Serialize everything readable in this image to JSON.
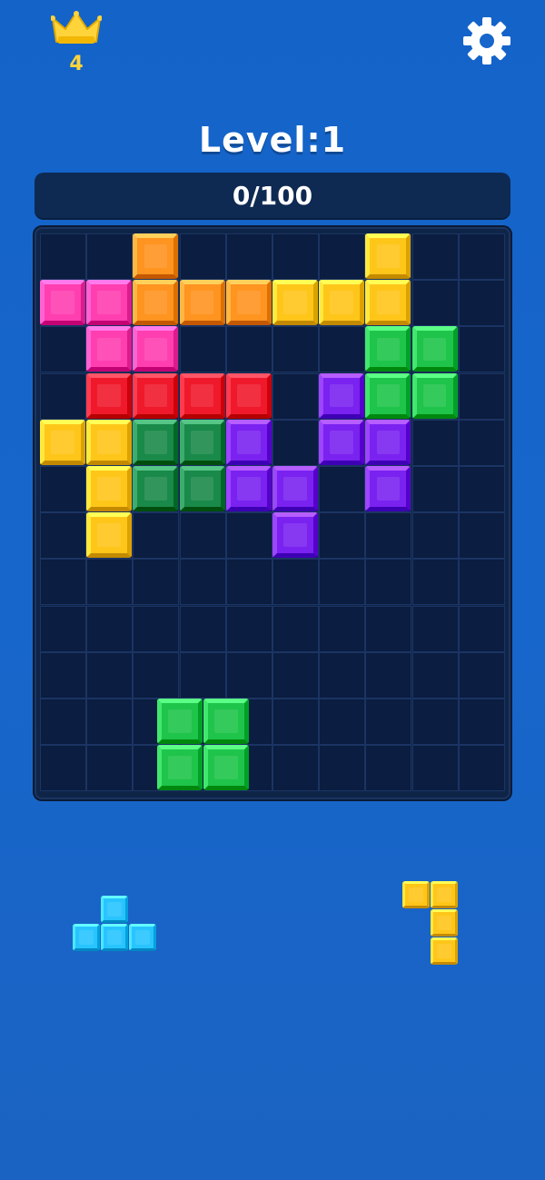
{
  "hud": {
    "crown_icon": "crown-icon",
    "crown_count": "4",
    "settings_icon": "gear-icon",
    "level_title": "Level:1",
    "progress_text": "0/100",
    "progress_fraction": 0
  },
  "colors": {
    "background": "#1766cc",
    "board": "#0f2548",
    "empty_cell": "#0b1d40",
    "orange": "#ff9420",
    "yellow": "#ffc61a",
    "pink": "#ff3fb0",
    "red": "#f0192c",
    "dark_green": "#1a8a4a",
    "green": "#1fc44a",
    "purple": "#7a22f0",
    "cyan": "#28c4ff"
  },
  "board": {
    "columns": 10,
    "rows": 12,
    "filled": [
      {
        "r": 0,
        "c": 2,
        "color": "orange"
      },
      {
        "r": 0,
        "c": 7,
        "color": "yellow"
      },
      {
        "r": 1,
        "c": 0,
        "color": "pink"
      },
      {
        "r": 1,
        "c": 1,
        "color": "pink"
      },
      {
        "r": 1,
        "c": 2,
        "color": "orange"
      },
      {
        "r": 1,
        "c": 3,
        "color": "orange"
      },
      {
        "r": 1,
        "c": 4,
        "color": "orange"
      },
      {
        "r": 1,
        "c": 5,
        "color": "yellow"
      },
      {
        "r": 1,
        "c": 6,
        "color": "yellow"
      },
      {
        "r": 1,
        "c": 7,
        "color": "yellow"
      },
      {
        "r": 2,
        "c": 1,
        "color": "pink"
      },
      {
        "r": 2,
        "c": 2,
        "color": "pink"
      },
      {
        "r": 2,
        "c": 7,
        "color": "green"
      },
      {
        "r": 2,
        "c": 8,
        "color": "green"
      },
      {
        "r": 3,
        "c": 1,
        "color": "red"
      },
      {
        "r": 3,
        "c": 2,
        "color": "red"
      },
      {
        "r": 3,
        "c": 3,
        "color": "red"
      },
      {
        "r": 3,
        "c": 4,
        "color": "red"
      },
      {
        "r": 3,
        "c": 6,
        "color": "purple"
      },
      {
        "r": 3,
        "c": 7,
        "color": "green"
      },
      {
        "r": 3,
        "c": 8,
        "color": "green"
      },
      {
        "r": 4,
        "c": 0,
        "color": "yellow"
      },
      {
        "r": 4,
        "c": 1,
        "color": "yellow"
      },
      {
        "r": 4,
        "c": 2,
        "color": "dark_green"
      },
      {
        "r": 4,
        "c": 3,
        "color": "dark_green"
      },
      {
        "r": 4,
        "c": 4,
        "color": "purple"
      },
      {
        "r": 4,
        "c": 6,
        "color": "purple"
      },
      {
        "r": 4,
        "c": 7,
        "color": "purple"
      },
      {
        "r": 5,
        "c": 1,
        "color": "yellow"
      },
      {
        "r": 5,
        "c": 2,
        "color": "dark_green"
      },
      {
        "r": 5,
        "c": 3,
        "color": "dark_green"
      },
      {
        "r": 5,
        "c": 4,
        "color": "purple"
      },
      {
        "r": 5,
        "c": 5,
        "color": "purple"
      },
      {
        "r": 5,
        "c": 7,
        "color": "purple"
      },
      {
        "r": 6,
        "c": 1,
        "color": "yellow"
      },
      {
        "r": 6,
        "c": 5,
        "color": "purple"
      }
    ]
  },
  "dragging_piece": {
    "color": "green",
    "shape": "2x2 square",
    "cells": [
      [
        0,
        0
      ],
      [
        0,
        1
      ],
      [
        1,
        0
      ],
      [
        1,
        1
      ]
    ]
  },
  "tray": [
    {
      "name": "cyan-t-piece",
      "color": "cyan",
      "cells": [
        [
          0,
          1
        ],
        [
          1,
          0
        ],
        [
          1,
          1
        ],
        [
          1,
          2
        ]
      ]
    },
    {
      "name": "yellow-j-piece",
      "color": "yellow",
      "cells": [
        [
          0,
          0
        ],
        [
          0,
          1
        ],
        [
          1,
          1
        ],
        [
          2,
          1
        ]
      ]
    }
  ]
}
